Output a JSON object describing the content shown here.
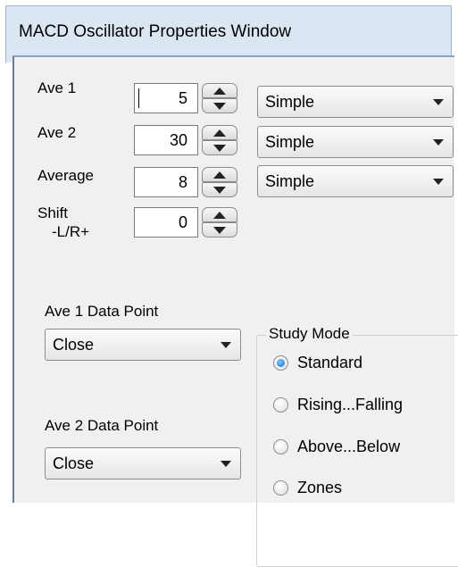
{
  "window": {
    "title": "MACD Oscillator Properties Window"
  },
  "fields": [
    {
      "label": "Ave 1",
      "value": "5",
      "type": "Simple"
    },
    {
      "label": "Ave 2",
      "value": "30",
      "type": "Simple"
    },
    {
      "label": "Average",
      "value": "8",
      "type": "Simple"
    },
    {
      "label_line1": "Shift",
      "label_line2": "-L/R+",
      "value": "0"
    }
  ],
  "data_points": {
    "ave1": {
      "label": "Ave 1 Data Point",
      "value": "Close"
    },
    "ave2": {
      "label": "Ave 2 Data Point",
      "value": "Close"
    }
  },
  "study_mode": {
    "legend": "Study Mode",
    "options": [
      "Standard",
      "Rising...Falling",
      "Above...Below",
      "Zones"
    ],
    "selected": "Standard"
  },
  "colors": {
    "titlebar": "#dbe6f3",
    "client": "#f0f0f0",
    "radio_selected": "#1c6fd1"
  },
  "icons": {
    "spin_up": "triangle-up-icon",
    "spin_down": "triangle-down-icon",
    "dropdown": "triangle-down-icon"
  }
}
